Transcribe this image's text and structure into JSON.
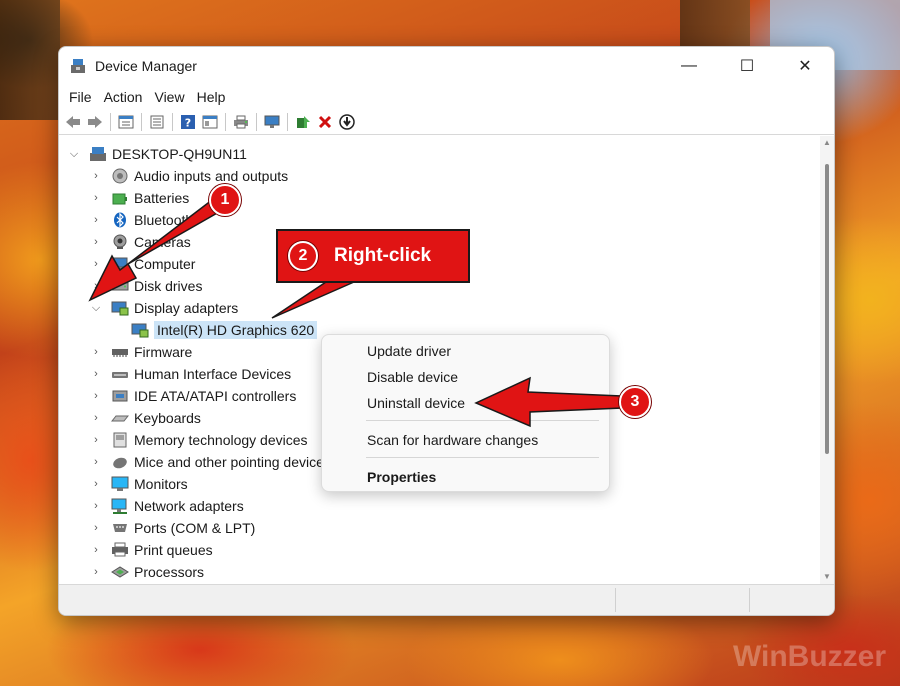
{
  "window": {
    "title": "Device Manager",
    "minimize": "—",
    "maximize": "☐",
    "close": "✕"
  },
  "menu": [
    "File",
    "Action",
    "View",
    "Help"
  ],
  "toolbar": [
    "back-icon",
    "forward-icon",
    "properties-icon",
    "update-icon",
    "help-icon",
    "view-icon",
    "print-icon",
    "monitor-icon",
    "enable-icon",
    "uninstall-icon",
    "download-icon"
  ],
  "tree": {
    "root": "DESKTOP-QH9UN11",
    "categories": [
      "Audio inputs and outputs",
      "Batteries",
      "Bluetooth",
      "Cameras",
      "Computer",
      "Disk drives",
      "Display adapters",
      "Firmware",
      "Human Interface Devices",
      "IDE ATA/ATAPI controllers",
      "Keyboards",
      "Memory technology devices",
      "Mice and other pointing devices",
      "Monitors",
      "Network adapters",
      "Ports (COM & LPT)",
      "Print queues",
      "Processors"
    ],
    "expanded_child": "Intel(R) HD Graphics 620"
  },
  "context_menu": {
    "update": "Update driver",
    "disable": "Disable device",
    "uninstall": "Uninstall device",
    "scan": "Scan for hardware changes",
    "properties": "Properties"
  },
  "annotations": {
    "step1": "1",
    "step2": "2",
    "step2_text": "Right-click",
    "step3": "3"
  },
  "watermark": "WinBuzzer",
  "colors": {
    "annotation_red": "#e01414",
    "selection": "#cce4f7"
  }
}
